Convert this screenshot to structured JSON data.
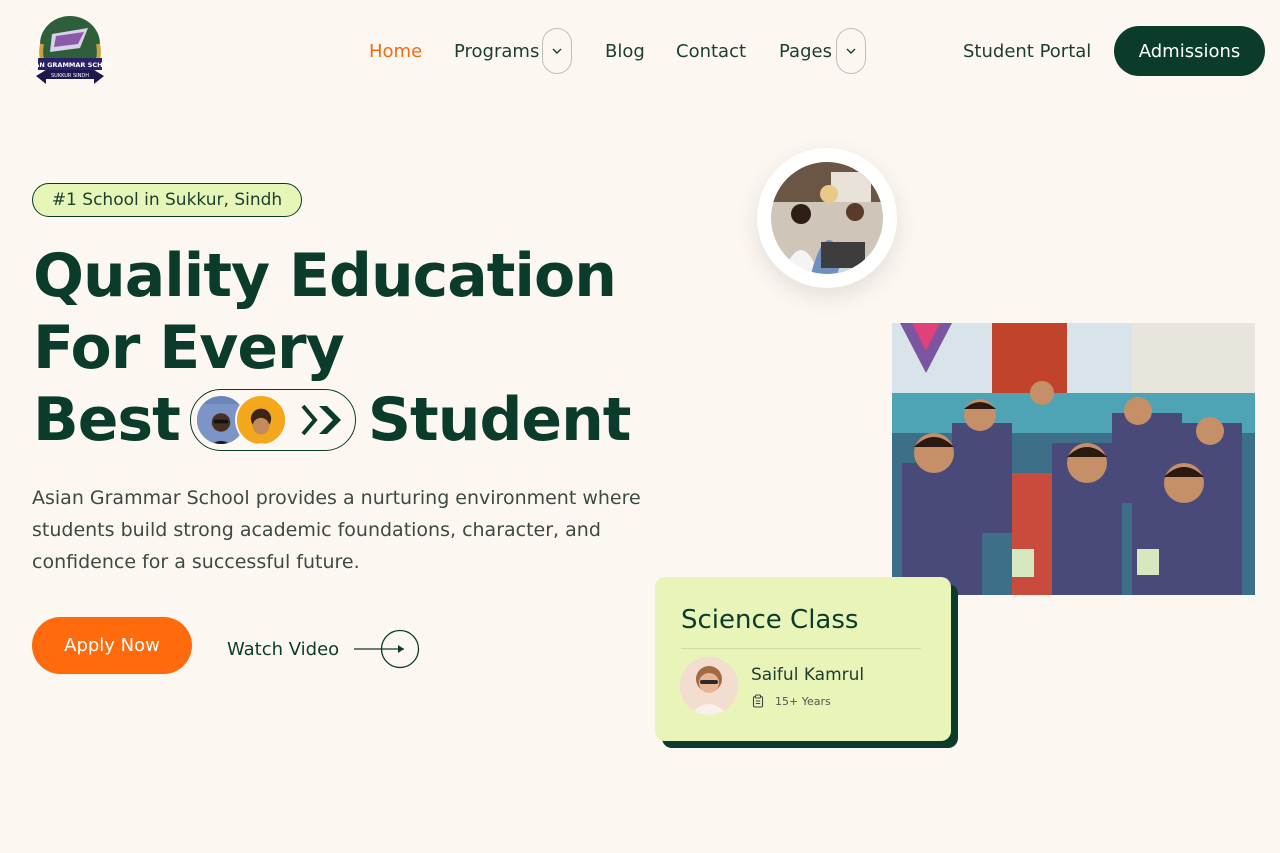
{
  "header": {
    "logo_text_top": "ASIAN GRAMMAR SCHOOL",
    "logo_text_bottom": "SUKKUR SINDH",
    "nav": [
      {
        "label": "Home",
        "active": true
      },
      {
        "label": "Programs",
        "has_dropdown": true
      },
      {
        "label": "Blog"
      },
      {
        "label": "Contact"
      },
      {
        "label": "Pages",
        "has_dropdown": true
      }
    ],
    "portal_label": "Student Portal",
    "cta_label": "Admissions"
  },
  "hero": {
    "badge": "#1 School in Sukkur, Sindh",
    "headline_line1": "Quality Education",
    "headline_line2": "For Every",
    "headline_line3a": "Best",
    "headline_line3b": "Student",
    "description": "Asian Grammar School provides a nurturing environment where students build strong academic foundations, character, and confidence for a successful future.",
    "apply_label": "Apply Now",
    "watch_label": "Watch Video"
  },
  "card": {
    "title": "Science Class",
    "teacher_name": "Saiful Kamrul",
    "experience": "15+ Years"
  },
  "colors": {
    "background": "#fdf7f1",
    "primary_dark": "#0b3b2a",
    "accent_orange": "#ff6a0d",
    "nav_active": "#f26b12",
    "badge_bg": "#e6f5b8",
    "card_bg": "#e8f4b8"
  },
  "icons": {
    "nav_dropdown": "chevron-down-icon",
    "watch": "arrow-right-circle-icon",
    "experience": "clipboard-icon"
  }
}
